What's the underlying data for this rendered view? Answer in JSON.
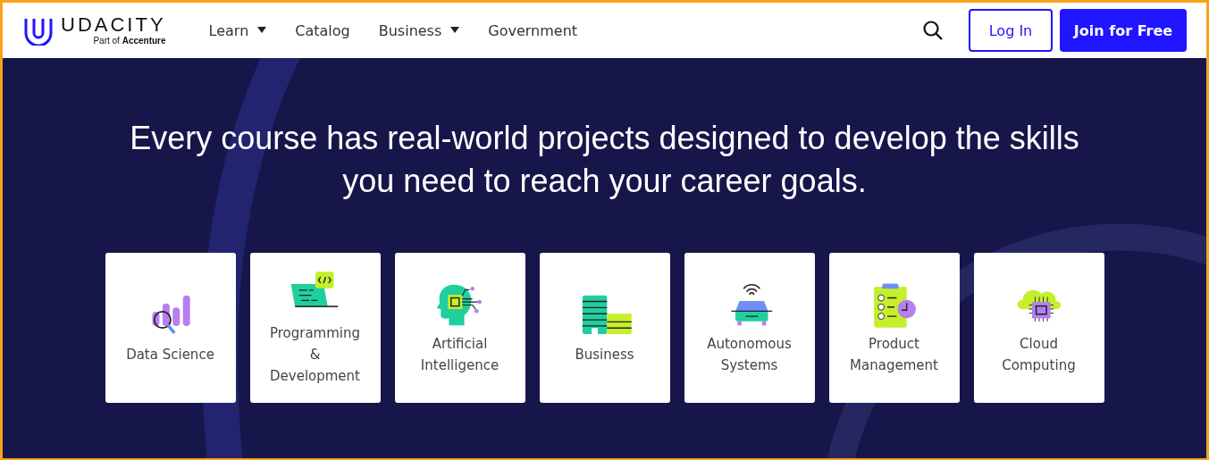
{
  "header": {
    "logo": {
      "name": "UDACITY",
      "tagline_prefix": "Part of ",
      "tagline_brand": "Accenture"
    },
    "nav": [
      {
        "label": "Learn",
        "has_menu": true
      },
      {
        "label": "Catalog",
        "has_menu": false
      },
      {
        "label": "Business",
        "has_menu": true
      },
      {
        "label": "Government",
        "has_menu": false
      }
    ],
    "login": "Log In",
    "join": "Join for Free"
  },
  "hero": {
    "heading": "Every course has real-world projects designed to develop the skills you need to reach your career goals.",
    "categories": [
      {
        "label": "Data Science",
        "kind": "chart"
      },
      {
        "label": "Programming & Development",
        "kind": "laptop"
      },
      {
        "label": "Artificial Intelligence",
        "kind": "head"
      },
      {
        "label": "Business",
        "kind": "building"
      },
      {
        "label": "Autonomous Systems",
        "kind": "car"
      },
      {
        "label": "Product Management",
        "kind": "clipboard"
      },
      {
        "label": "Cloud Computing",
        "kind": "cloud"
      }
    ]
  }
}
